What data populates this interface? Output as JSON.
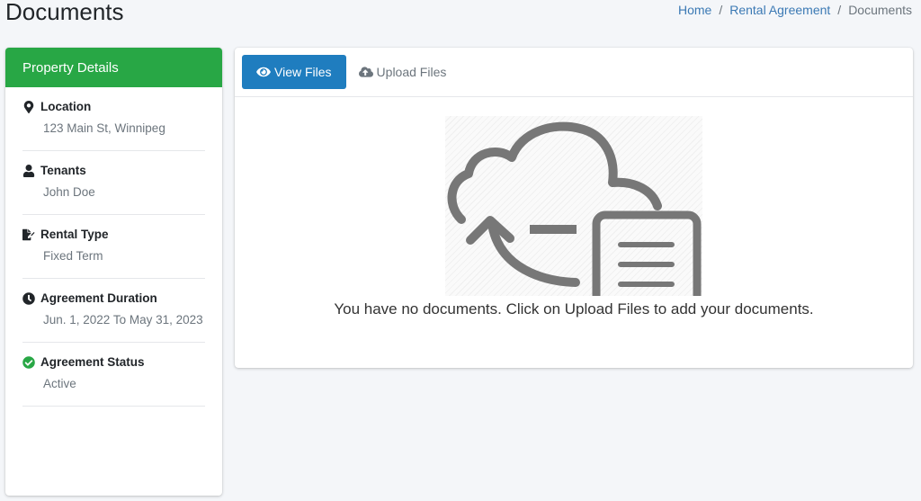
{
  "page_title": "Documents",
  "breadcrumb": {
    "items": [
      "Home",
      "Rental Agreement"
    ],
    "separator": "/",
    "current": "Documents"
  },
  "property_details": {
    "header": "Property Details",
    "items": [
      {
        "icon": "map-marker-icon",
        "label": "Location",
        "value": "123 Main St, Winnipeg"
      },
      {
        "icon": "user-icon",
        "label": "Tenants",
        "value": "John Doe"
      },
      {
        "icon": "file-signature-icon",
        "label": "Rental Type",
        "value": "Fixed Term"
      },
      {
        "icon": "clock-icon",
        "label": "Agreement Duration",
        "value": "Jun. 1, 2022 To May 31, 2023"
      },
      {
        "icon": "check-circle-icon",
        "label": "Agreement Status",
        "value": "Active"
      }
    ]
  },
  "tabs": [
    {
      "label": "View Files",
      "icon": "eye-icon",
      "active": true
    },
    {
      "label": "Upload Files",
      "icon": "cloud-upload-icon",
      "active": false
    }
  ],
  "empty_state": {
    "message": "You have no documents. Click on Upload Files to add your documents."
  },
  "colors": {
    "header_green": "#28a745",
    "active_tab_blue": "#1f7dbf",
    "link_blue": "#3b79b4"
  }
}
